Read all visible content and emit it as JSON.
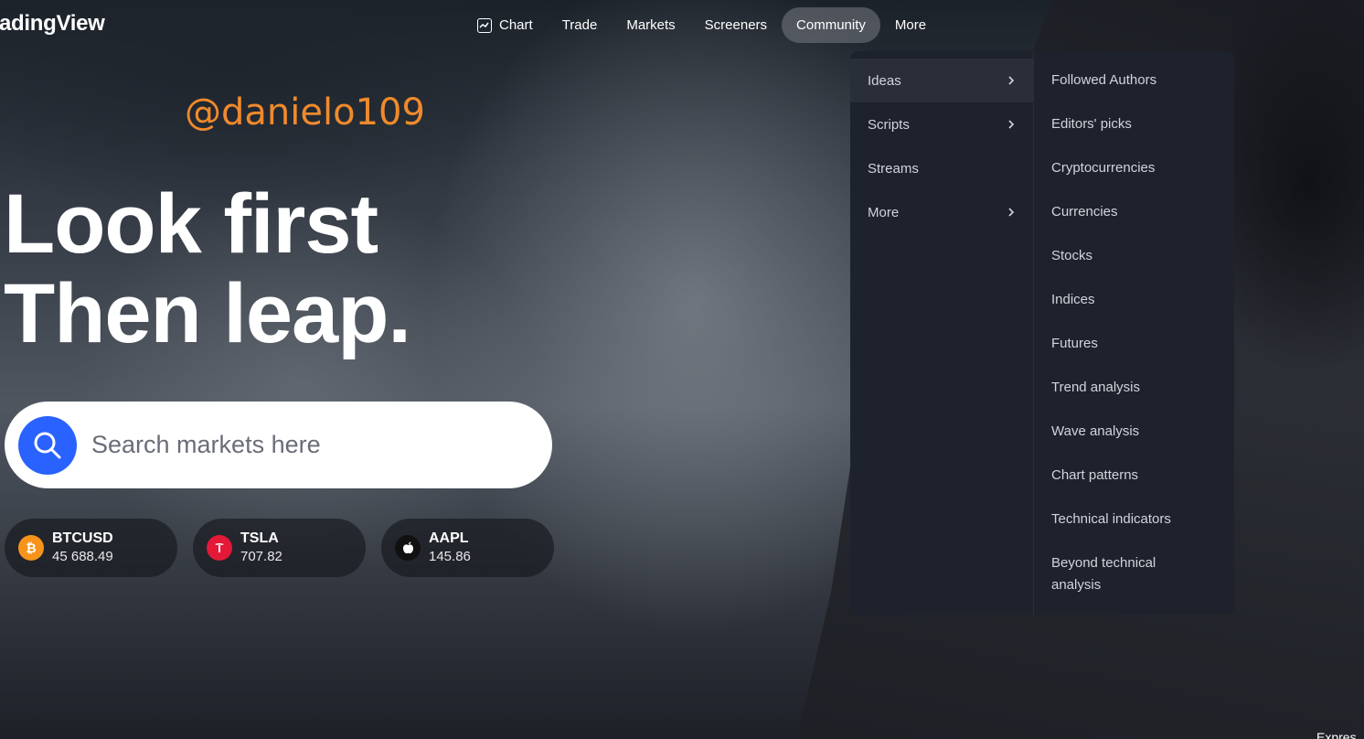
{
  "header": {
    "logo": "adingView",
    "nav": [
      "Chart",
      "Trade",
      "Markets",
      "Screeners",
      "Community",
      "More"
    ],
    "active": "Community"
  },
  "watermark": "@danielo109",
  "hero": {
    "line1": "Look first",
    "line2": "Then leap."
  },
  "search": {
    "placeholder": "Search markets here"
  },
  "tickers": [
    {
      "symbol": "BTCUSD",
      "value": "45 688.49",
      "icon_color": "#f7931a"
    },
    {
      "symbol": "TSLA",
      "value": "707.82",
      "icon_color": "#e31937"
    },
    {
      "symbol": "AAPL",
      "value": "145.86",
      "icon_color": "#111111"
    }
  ],
  "menu": {
    "left": [
      {
        "label": "Ideas",
        "submenu": true
      },
      {
        "label": "Scripts",
        "submenu": true
      },
      {
        "label": "Streams",
        "submenu": false
      },
      {
        "label": "More",
        "submenu": true
      }
    ],
    "right": [
      "Followed Authors",
      "Editors' picks",
      "Cryptocurrencies",
      "Currencies",
      "Stocks",
      "Indices",
      "Futures",
      "Trend analysis",
      "Wave analysis",
      "Chart patterns",
      "Technical indicators",
      "Beyond technical analysis"
    ]
  },
  "corner_text": "Expres",
  "colors": {
    "accent": "#2962ff",
    "menu_bg": "#1e222d",
    "watermark": "#f08a2c"
  }
}
